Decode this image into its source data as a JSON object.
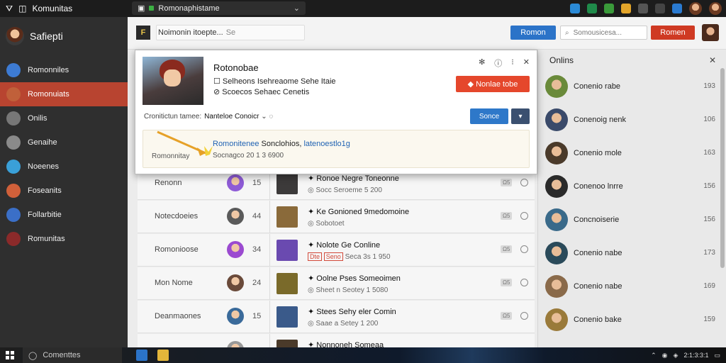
{
  "topbar": {
    "app_title": "Komunitas",
    "address": "Romonaphistame",
    "colors": {
      "accent_red": "#cf3a23",
      "accent_blue": "#2b73c8"
    }
  },
  "sidebar": {
    "username": "Safiepti",
    "items": [
      {
        "label": "Romonniles",
        "icon": "globe-avatar-icon",
        "color": "#3d7bd3"
      },
      {
        "label": "Romonuiats",
        "icon": "user-avatar-icon",
        "color": "#c0603a",
        "active": true
      },
      {
        "label": "Onilis",
        "icon": "box-icon",
        "color": "#777777"
      },
      {
        "label": "Genaihe",
        "icon": "cube-icon",
        "color": "#8a8a8a"
      },
      {
        "label": "Noeenes",
        "icon": "earth-icon",
        "color": "#3aa0d8"
      },
      {
        "label": "Foseanits",
        "icon": "character-icon",
        "color": "#d0603a"
      },
      {
        "label": "Follarbitie",
        "icon": "shield-icon",
        "color": "#3b6fc7"
      },
      {
        "label": "Romunitas",
        "icon": "group-icon",
        "color": "#8b2a2a"
      }
    ]
  },
  "toolbar": {
    "logo_text": "F",
    "search_value": "Noimonin itoepte...",
    "search_placeholder": "Se",
    "blue_button": "Romon",
    "search2_placeholder": "Somousicesa...",
    "red_button": "Romen"
  },
  "popup": {
    "title": "Rotonobae",
    "line1": "Selheons Isehreaome Sehe Itaie",
    "line2": "Scoecos Sehaec Cenetis",
    "icons": [
      "sun-icon",
      "info-icon",
      "dots-icon",
      "close-icon"
    ],
    "cta_button": "Nonlae tobe",
    "label": "Cronitictun tamee:",
    "label_value": "Nanteloe Conoicr",
    "blue_button": "Sonce",
    "dark_button": "▾",
    "notice": {
      "sub_label": "Romonnitay",
      "link_a": "Romonitenee",
      "link_b": "Sonclohios,",
      "link_c": "latenoestlo1g",
      "date": "Socnagco 20 1 3 6900"
    }
  },
  "table": {
    "rows": [
      {
        "name": "Renonn",
        "num": "15",
        "avatar_color": "#8e5bd6",
        "game_title": "Ronoe Negre Toneonne",
        "game_sub": "Socc Seroeme 5 200",
        "badge": "Ω5",
        "thumb_color": "#3c3a3a"
      },
      {
        "name": "Notecdoeies",
        "num": "44",
        "avatar_color": "#5a5a5a",
        "game_title": "Ke Gonioned 9medomoine",
        "game_sub": "Sobotoet",
        "badge": "Ω5",
        "thumb_color": "#8a6a3a"
      },
      {
        "name": "Romonioose",
        "num": "34",
        "avatar_color": "#9b4ad0",
        "game_title": "Nolote Ge Conline",
        "game_sub": "Seca 3s 1 950",
        "tag_a": "Dte",
        "tag_b": "Seno",
        "badge": "Ω5",
        "thumb_color": "#6a4ab0"
      },
      {
        "name": "Mon Nome",
        "num": "24",
        "avatar_color": "#6a4a3a",
        "game_title": "Oolne Pses Someoimen",
        "game_sub": "Sheet n Seotey 1 5080",
        "badge": "Ω5",
        "thumb_color": "#7a6a2a"
      },
      {
        "name": "Deanmaones",
        "num": "15",
        "avatar_color": "#3a6a9a",
        "game_title": "Stees Sehy eler Comin",
        "game_sub": "Saae a Setey 1 200",
        "badge": "Ω5",
        "thumb_color": "#3a5a8a"
      },
      {
        "name": "",
        "num": "",
        "avatar_color": "#999999",
        "game_title": "Nonnoneh Someaa",
        "game_sub": "",
        "badge": "",
        "thumb_color": "#4a3a2a"
      }
    ]
  },
  "rightpanel": {
    "title": "Onlins",
    "items": [
      {
        "name": "Conenio rabe",
        "count": "193",
        "color": "#6a8a3a"
      },
      {
        "name": "Conenoig nenk",
        "count": "106",
        "color": "#3a4a6a"
      },
      {
        "name": "Conenio mole",
        "count": "163",
        "color": "#4a3a2a"
      },
      {
        "name": "Conenoo lnrre",
        "count": "156",
        "color": "#2a2a2a"
      },
      {
        "name": "Concnoiserie",
        "count": "156",
        "color": "#3a6a8a"
      },
      {
        "name": "Conenio nabe",
        "count": "173",
        "color": "#2a4a5a"
      },
      {
        "name": "Conenio nabe",
        "count": "169",
        "color": "#8a6a4a"
      },
      {
        "name": "Conenio bake",
        "count": "159",
        "color": "#9a7a3a"
      }
    ]
  },
  "taskbar": {
    "search_placeholder": "Comenttes",
    "tray_text": "2:1:3:3:1"
  }
}
